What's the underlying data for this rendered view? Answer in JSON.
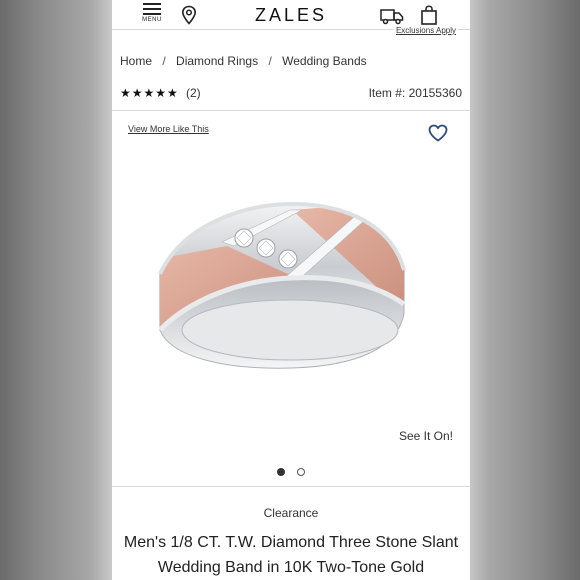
{
  "header": {
    "menu_label": "MENU",
    "logo": "ZALES",
    "exclusions_link": "Exclusions Apply"
  },
  "breadcrumb": {
    "items": [
      "Home",
      "Diamond Rings",
      "Wedding Bands"
    ],
    "separator": "/"
  },
  "rating": {
    "stars": "★★★★★",
    "value": 5,
    "count": "(2)"
  },
  "item_number": "Item #: 20155360",
  "gallery": {
    "view_more": "View More Like This",
    "see_it_on": "See It On!",
    "slides": 2,
    "active_slide": 1
  },
  "product": {
    "badge": "Clearance",
    "title": "Men's 1/8 CT. T.W. Diamond Three Stone Slant Wedding Band in 10K Two-Tone Gold"
  },
  "icons": {
    "menu": "hamburger-menu-icon",
    "store": "location-pin-icon",
    "shipping": "truck-icon",
    "cart": "shopping-bag-icon",
    "favorite": "heart-icon"
  },
  "colors": {
    "accent_blue": "#2b4a7a",
    "rose_gold": "#d9a190",
    "white_gold": "#d7dadd",
    "text": "#333333"
  }
}
